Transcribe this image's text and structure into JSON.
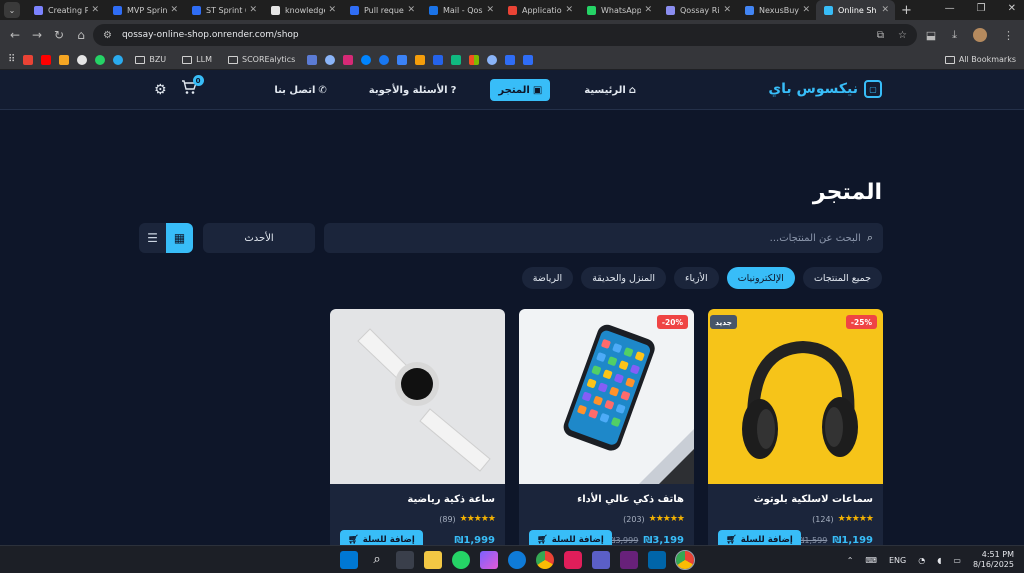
{
  "browser": {
    "tabs": [
      {
        "title": "Creating P",
        "color": "#7c83ff"
      },
      {
        "title": "MVP Sprint",
        "color": "#2f6df6"
      },
      {
        "title": "ST Sprint 6",
        "color": "#2f6df6"
      },
      {
        "title": "knowledge",
        "color": "#e5e5e5"
      },
      {
        "title": "Pull reque",
        "color": "#2f6df6"
      },
      {
        "title": "Mail - Qos",
        "color": "#1a73e8"
      },
      {
        "title": "Application",
        "color": "#ea4335"
      },
      {
        "title": "WhatsApp",
        "color": "#25d366"
      },
      {
        "title": "Qossay Ri",
        "color": "#8a8df0"
      },
      {
        "title": "NexusBuy",
        "color": "#4285f4"
      },
      {
        "title": "Online Sh",
        "color": "#38bdf8",
        "active": true
      }
    ],
    "url": "qossay-online-shop.onrender.com/shop",
    "bookmarks": {
      "folders": [
        "BZU",
        "LLM",
        "SCOREalytics"
      ],
      "all_label": "All Bookmarks"
    }
  },
  "site": {
    "brand": "نيكسوس باي",
    "nav": [
      {
        "label": "الرئيسية",
        "icon": "⌂",
        "active": false
      },
      {
        "label": "المتجر",
        "icon": "▣",
        "active": true
      },
      {
        "label": "الأسئلة والأجوبة",
        "icon": "?",
        "active": false
      },
      {
        "label": "اتصل بنا",
        "icon": "✆",
        "active": false
      }
    ],
    "cart_count": "0",
    "page_title": "المتجر",
    "search_placeholder": "البحث عن المنتجات...",
    "sort_value": "الأحدث",
    "categories": [
      {
        "label": "جميع المنتجات",
        "active": false
      },
      {
        "label": "الإلكترونيات",
        "active": true
      },
      {
        "label": "الأزياء",
        "active": false
      },
      {
        "label": "المنزل والحديقة",
        "active": false
      },
      {
        "label": "الرياضة",
        "active": false
      }
    ],
    "products": [
      {
        "name": "سماعات لاسلكية بلوتوث",
        "rating_count": "(124)",
        "price": "₪1,199",
        "old_price": "₪1,599",
        "discount": "-25%",
        "new_badge": "جديد",
        "add_label": "إضافة للسلة",
        "art": "headphones"
      },
      {
        "name": "هاتف ذكي عالي الأداء",
        "rating_count": "(203)",
        "price": "₪3,199",
        "old_price": "₪3,999",
        "discount": "-20%",
        "new_badge": "",
        "add_label": "إضافة للسلة",
        "art": "phone"
      },
      {
        "name": "ساعة ذكية رياضية",
        "rating_count": "(89)",
        "price": "₪1,999",
        "old_price": "",
        "discount": "",
        "new_badge": "",
        "add_label": "إضافة للسلة",
        "art": "watch"
      }
    ],
    "stars": "★★★★★",
    "accent": "#38bdf8"
  },
  "taskbar": {
    "lang": "ENG",
    "time": "4:51 PM",
    "date": "8/16/2025"
  }
}
